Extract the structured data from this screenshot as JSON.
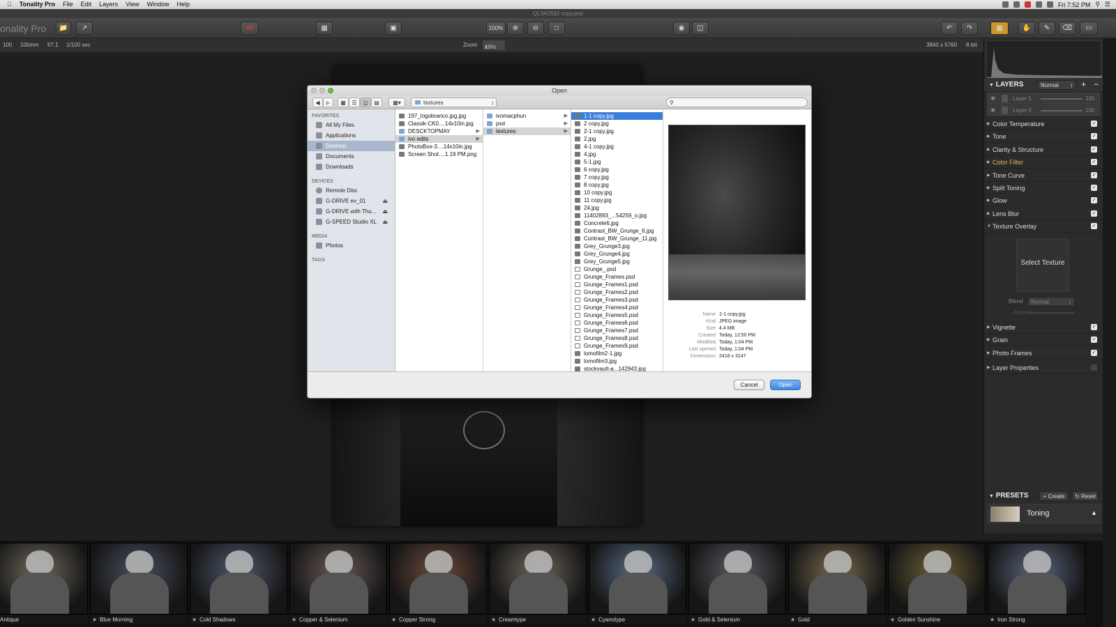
{
  "menubar": {
    "app": "Tonality Pro",
    "items": [
      "File",
      "Edit",
      "Layers",
      "View",
      "Window",
      "Help"
    ],
    "clock": "Fri 7:52 PM"
  },
  "window": {
    "title": "QL3A2592 copy.psd",
    "app_label": "onality Pro"
  },
  "toolbar": {
    "zoom_value": "100%"
  },
  "infobar": {
    "iso": "100",
    "focal": "100mm",
    "aperture": "f/7.1",
    "shutter": "1/100 sec",
    "zoom_label": "Zoom",
    "zoom_pct": "18%",
    "dims": "3840 x 5760",
    "bit": "8-bit"
  },
  "dialog": {
    "title": "Open",
    "location": "textures",
    "sidebar": {
      "favorites_header": "FAVORITES",
      "favorites": [
        "All My Files",
        "Applications",
        "Desktop",
        "Documents",
        "Downloads"
      ],
      "devices_header": "DEVICES",
      "devices": [
        "Remote Disc",
        "G-DRIVE ev_01",
        "G-DRIVE with Thu...",
        "G-SPEED Studio XL"
      ],
      "media_header": "MEDIA",
      "media": [
        "Photos"
      ],
      "tags_header": "TAGS"
    },
    "col1": [
      "197_logobranco.jpg.jpg",
      "Classik-CK0....14x10in.jpg",
      "DESCKTOPMAY",
      "ivo edits",
      "PhotoBox-3....14x10in.jpg",
      "Screen Shot....1.19 PM.png"
    ],
    "col2": [
      "ivomacphun",
      "psd",
      "textures"
    ],
    "col3": [
      "1-1 copy.jpg",
      "2 copy.jpg",
      "2-1 copy.jpg",
      "2.jpg",
      "4-1 copy.jpg",
      "4.jpg",
      "5-1.jpg",
      "6 copy.jpg",
      "7 copy.jpg",
      "8 copy.jpg",
      "10 copy.jpg",
      "11 copy.jpg",
      "24.jpg",
      "11402893_...54259_o.jpg",
      "Concrete6.jpg",
      "Contrast_BW_Grunge_6.jpg",
      "Contrast_BW_Grunge_11.jpg",
      "Grey_Grunge3.jpg",
      "Grey_Grunge4.jpg",
      "Grey_Grunge5.jpg",
      "Grunge_.psd",
      "Grunge_Frames.psd",
      "Grunge_Frames1.psd",
      "Grunge_Frames2.psd",
      "Grunge_Frames3.psd",
      "Grunge_Frames4.psd",
      "Grunge_Frames5.psd",
      "Grunge_Frames6.psd",
      "Grunge_Frames7.psd",
      "Grunge_Frames8.psd",
      "Grunge_Frames9.psd",
      "lomofilm2-1.jpg",
      "lomofilm3.jpg",
      "stockvault-a...142943.jpg"
    ],
    "preview": [
      {
        "k": "Name",
        "v": "1-1 copy.jpg"
      },
      {
        "k": "Kind",
        "v": "JPEG image"
      },
      {
        "k": "Size",
        "v": "4.4 MB"
      },
      {
        "k": "Created",
        "v": "Today, 12:50 PM"
      },
      {
        "k": "Modified",
        "v": "Today, 1:04 PM"
      },
      {
        "k": "Last opened",
        "v": "Today, 1:04 PM"
      },
      {
        "k": "Dimensions",
        "v": "2418 x 3147"
      }
    ],
    "cancel": "Cancel",
    "open": "Open"
  },
  "panel": {
    "layers_title": "LAYERS",
    "blend_mode": "Normal",
    "layers": [
      {
        "name": "Layer 1",
        "opacity": "100"
      },
      {
        "name": "Layer 0",
        "opacity": "100"
      }
    ],
    "adjustments": [
      "Color Temperature",
      "Tone",
      "Clarity & Structure",
      "Color Filter",
      "Tone Curve",
      "Split Toning",
      "Glow",
      "Lens Blur",
      "Texture Overlay"
    ],
    "texture_select": "Select Texture",
    "blend_label": "Blend",
    "blend_value": "Normal",
    "amount_label": "Amount",
    "adjustments2": [
      "Vignette",
      "Grain",
      "Photo Frames",
      "Layer Properties"
    ],
    "presets_title": "PRESETS",
    "create": "Create",
    "reset": "Reset",
    "preset_current": "Toning"
  },
  "presets": [
    "Antique",
    "Blue Morning",
    "Cold Shadows",
    "Copper & Selenium",
    "Copper Strong",
    "Creamtype",
    "Cyanotype",
    "Gold & Selenium",
    "Gold",
    "Golden Sunshine",
    "Iron Strong"
  ],
  "preset_tints": [
    "#6f6a5c",
    "#4a5060",
    "#505a6e",
    "#6a5c58",
    "#6e4c3c",
    "#6e665a",
    "#5a6e86",
    "#5e5c66",
    "#786a4e",
    "#6c6038",
    "#5c6880"
  ]
}
